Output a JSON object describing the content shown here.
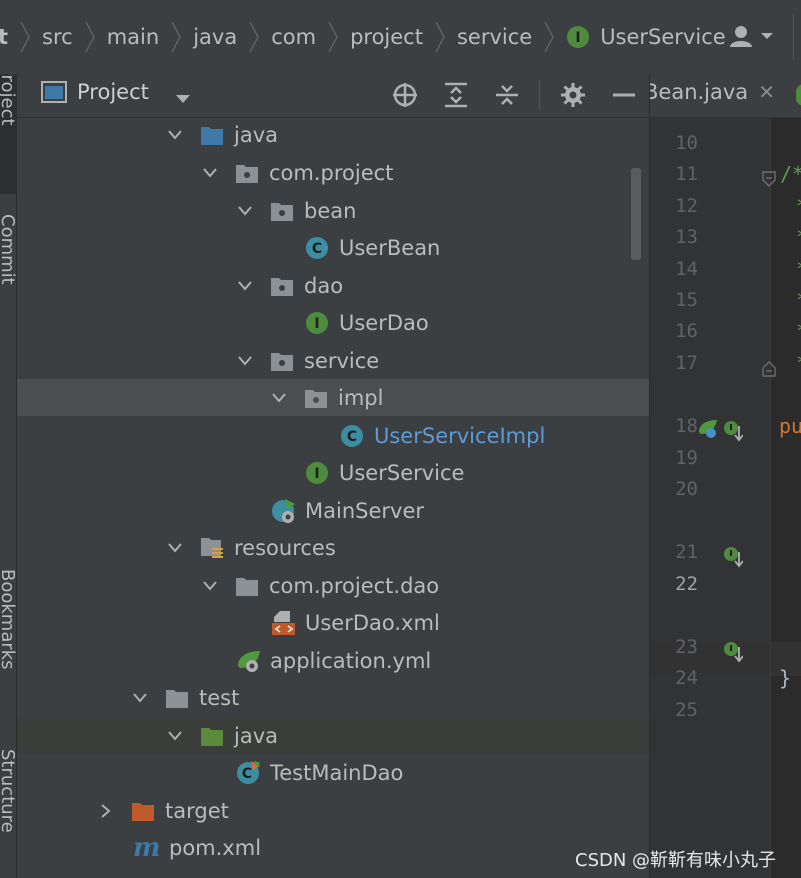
{
  "breadcrumb": {
    "items": [
      "t",
      "src",
      "main",
      "java",
      "com",
      "project",
      "service",
      "UserService"
    ],
    "last_icon": "interface-icon"
  },
  "left_strip": {
    "tabs": [
      "Project",
      "Commit",
      "Bookmarks",
      "Structure"
    ]
  },
  "project_panel": {
    "title": "Project",
    "toolbar": [
      "locate-icon",
      "expand-all-icon",
      "collapse-all-icon",
      "gear-icon",
      "minimize-icon"
    ]
  },
  "tree": [
    {
      "label": "java",
      "icon": "source-folder-icon",
      "expanded": true
    },
    {
      "label": "com.project",
      "icon": "package-icon",
      "expanded": true
    },
    {
      "label": "bean",
      "icon": "package-icon",
      "expanded": true
    },
    {
      "label": "UserBean",
      "icon": "class-icon"
    },
    {
      "label": "dao",
      "icon": "package-icon",
      "expanded": true
    },
    {
      "label": "UserDao",
      "icon": "interface-icon"
    },
    {
      "label": "service",
      "icon": "package-icon",
      "expanded": true
    },
    {
      "label": "impl",
      "icon": "package-icon",
      "expanded": true,
      "selected": true
    },
    {
      "label": "UserServiceImpl",
      "icon": "class-icon"
    },
    {
      "label": "UserService",
      "icon": "interface-icon"
    },
    {
      "label": "MainServer",
      "icon": "spring-boot-class-icon"
    },
    {
      "label": "resources",
      "icon": "resources-folder-icon",
      "expanded": true
    },
    {
      "label": "com.project.dao",
      "icon": "folder-icon",
      "expanded": true
    },
    {
      "label": "UserDao.xml",
      "icon": "xml-file-icon"
    },
    {
      "label": "application.yml",
      "icon": "spring-config-icon"
    },
    {
      "label": "test",
      "icon": "folder-icon",
      "expanded": true
    },
    {
      "label": "java",
      "icon": "test-source-folder-icon",
      "expanded": true
    },
    {
      "label": "TestMainDao",
      "icon": "test-class-icon"
    },
    {
      "label": "target",
      "icon": "excluded-folder-icon",
      "expanded": false
    },
    {
      "label": "pom.xml",
      "icon": "maven-icon"
    }
  ],
  "editor": {
    "tab_label": "Bean.java",
    "line_numbers": [
      "10",
      "11",
      "12",
      "13",
      "14",
      "15",
      "16",
      "17",
      "18",
      "19",
      "20",
      "21",
      "22",
      "23",
      "24",
      "25"
    ],
    "current_line": "22",
    "code": {
      "comment_start": "/*",
      "comment_star": "*",
      "public_fragment": "pu",
      "closing_brace": "}"
    }
  },
  "watermark": "CSDN @靳靳有味小丸子",
  "colors": {
    "background": "#2b2b2b",
    "panel": "#3c3f41",
    "selection": "#4b4d4f",
    "class_icon": "#3d8ea3",
    "interface_icon": "#4e8b3d",
    "folder": "#8c9196",
    "source_folder": "#3d7aa8",
    "test_folder": "#5c8a3c",
    "excluded_folder": "#c05a2c"
  }
}
